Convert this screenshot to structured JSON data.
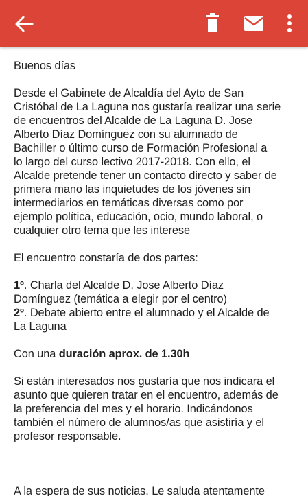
{
  "colors": {
    "appbar": "#db4437",
    "icon": "#ffffff",
    "text": "#1f1f1f"
  },
  "toolbar": {
    "icons": [
      "back-arrow-icon",
      "delete-icon",
      "mail-icon",
      "more-vert-icon"
    ]
  },
  "email": {
    "greeting": "Buenos días",
    "intro_lines": [
      "Desde el Gabinete de Alcaldía del Ayto de San",
      "Cristóbal de La Laguna nos gustaría realizar una serie",
      "de encuentros del Alcalde de La Laguna D. Jose",
      "Alberto Díaz Domínguez con su alumnado de",
      "Bachiller o último curso de Formación Profesional a",
      "lo largo del curso lectivo 2017-2018. Con ello, el",
      "Alcalde pretende tener un contacto directo y saber de",
      "primera mano las inquietudes de los jóvenes sin",
      "intermediarios en temáticas diversas como por",
      "ejemplo  política, educación, ocio, mundo laboral, o",
      "cualquier otro tema que les interese"
    ],
    "parts_intro": "El encuentro constaría de dos partes:",
    "part1_marker": "1º",
    "part1_line1": ". Charla del Alcalde D. Jose Alberto Díaz",
    "part1_line2": "Domínguez (temática a elegir por el centro)",
    "part2_marker": "2º",
    "part2_line1": ". Debate abierto entre el alumnado y el Alcalde de",
    "part2_line2": "La Laguna",
    "duration_prefix": "Con una ",
    "duration_bold": "duración aprox. de 1.30h",
    "interest_lines": [
      "Si están interesados nos gustaría que nos indicara el",
      "asunto que quieren tratar en el encuentro, además de",
      "la preferencia del mes y el horario. Indicándonos",
      "también el número de alumnos/as que asistiría y el",
      "profesor responsable."
    ],
    "closing": "A la espera de sus noticias. Le saluda atentamente"
  }
}
